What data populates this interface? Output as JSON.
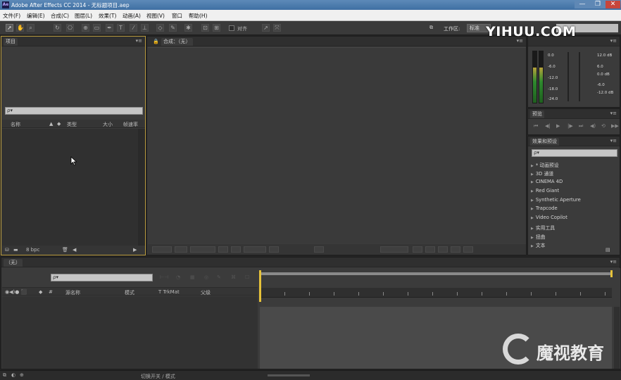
{
  "window": {
    "title": "Adobe After Effects CC 2014 - 无标题项目.aep",
    "logo": "Ae",
    "min": "—",
    "max": "❐",
    "close": "✕"
  },
  "menu": [
    "文件(F)",
    "编辑(E)",
    "合成(C)",
    "图层(L)",
    "效果(T)",
    "动画(A)",
    "视图(V)",
    "窗口",
    "帮助(H)"
  ],
  "toolbar": {
    "snap_label": "对齐",
    "workspace_label": "工作区:",
    "workspace_value": "标准"
  },
  "project_panel": {
    "tab": "项目",
    "search_placeholder": "ρ▾",
    "columns": [
      "名称",
      "类型",
      "大小",
      "帧速率"
    ],
    "footer_bpc": "8 bpc"
  },
  "composition_panel": {
    "tab": "合成：（无）"
  },
  "audio_panel": {
    "db_left": [
      "0.0",
      "-6.0",
      "-12.0",
      "-18.0",
      "-24.0"
    ],
    "db_right": [
      "12.0 dB",
      "6.0",
      "0.0 dB",
      "-6.0",
      "-12.0 dB"
    ]
  },
  "preview_panel": {
    "tab": "预览"
  },
  "effects_panel": {
    "tab": "效果和预设",
    "search_placeholder": "ρ▾",
    "items": [
      "* 动画预设",
      "3D 通道",
      "CINEMA 4D",
      "Red Giant",
      "Synthetic Aperture",
      "Trapcode",
      "Video Copilot",
      "实用工具",
      "扭曲",
      "文本"
    ]
  },
  "timeline_panel": {
    "tab": "（无）",
    "search_placeholder": "ρ▾",
    "columns": [
      "源名称",
      "模式",
      "T  TrkMat",
      "父级"
    ]
  },
  "statusbar": {
    "toggle_label": "切换开关 / 模式"
  },
  "watermark": {
    "top": "YIHUU.COM",
    "bottom": "魔视教育"
  }
}
